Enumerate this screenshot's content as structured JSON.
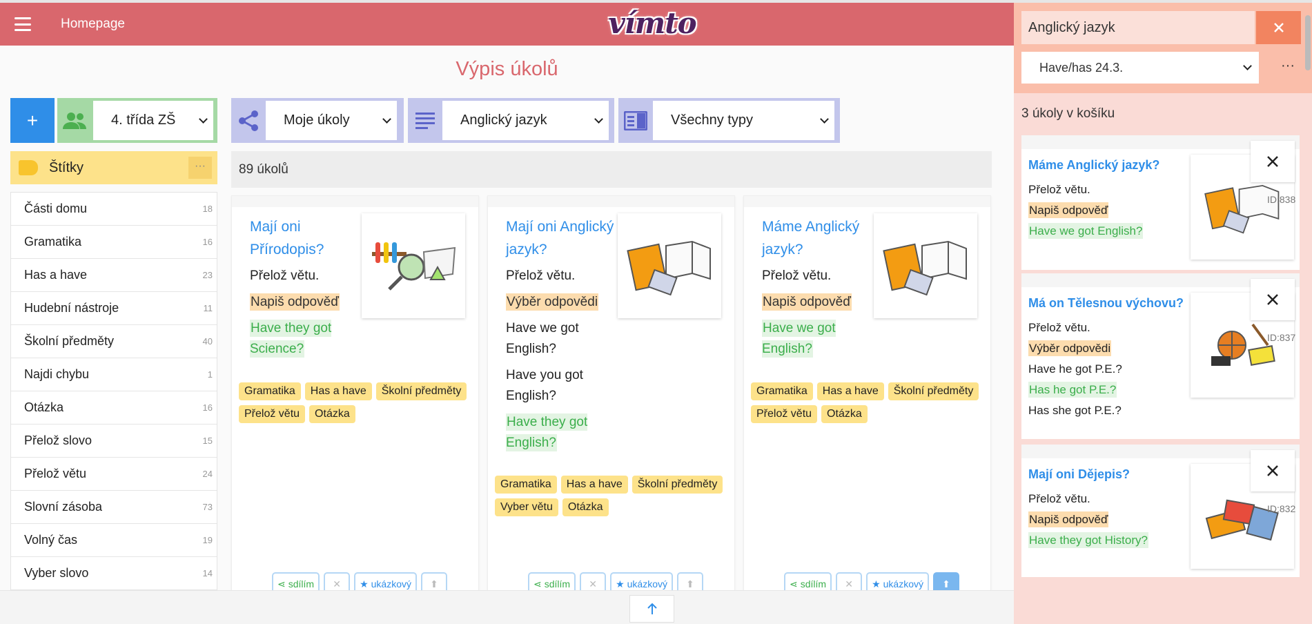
{
  "header": {
    "home_label": "Homepage",
    "logo_text": "vímto"
  },
  "page_title": "Výpis úkolů",
  "left": {
    "class_select": "4. třída ZŠ",
    "tags_label": "Štítky",
    "tags_more": "···",
    "tags": [
      {
        "label": "Části domu",
        "count": "18"
      },
      {
        "label": "Gramatika",
        "count": "16"
      },
      {
        "label": "Has a have",
        "count": "23"
      },
      {
        "label": "Hudební nástroje",
        "count": "11"
      },
      {
        "label": "Školní předměty",
        "count": "40"
      },
      {
        "label": "Najdi chybu",
        "count": "1"
      },
      {
        "label": "Otázka",
        "count": "16"
      },
      {
        "label": "Přelož slovo",
        "count": "15"
      },
      {
        "label": "Přelož větu",
        "count": "24"
      },
      {
        "label": "Slovní zásoba",
        "count": "73"
      },
      {
        "label": "Volný čas",
        "count": "19"
      },
      {
        "label": "Vyber slovo",
        "count": "14"
      }
    ]
  },
  "filters": {
    "owner": "Moje úkoly",
    "subject": "Anglický jazyk",
    "type": "Všechny typy"
  },
  "task_count": "89 úkolů",
  "cards": [
    {
      "title": "Mají oni Přírodopis?",
      "instruction": "Přelož větu.",
      "answer_type": "Napiš odpověď",
      "answer": "Have they got Science?",
      "chips": [
        "Gramatika",
        "Has a have",
        "Školní předměty",
        "Přelož větu",
        "Otázka"
      ]
    },
    {
      "title": "Mají oni Anglický jazyk?",
      "instruction": "Přelož větu.",
      "answer_type": "Výběr odpovědi",
      "option1": "Have we got English?",
      "option2": "Have you got English?",
      "answer": "Have they got English?",
      "chips": [
        "Gramatika",
        "Has a have",
        "Školní předměty",
        "Vyber větu",
        "Otázka"
      ]
    },
    {
      "title": "Máme Anglický jazyk?",
      "instruction": "Přelož větu.",
      "answer_type": "Napiš odpověď",
      "answer": "Have we got English?",
      "chips": [
        "Gramatika",
        "Has a have",
        "Školní předměty",
        "Přelož větu",
        "Otázka"
      ]
    }
  ],
  "card_actions": {
    "share": "sdílím",
    "example": "ukázkový"
  },
  "panel": {
    "subject": "Anglický jazyk",
    "set_select": "Have/has 24.3.",
    "more": "···",
    "basket_count": "3 úkoly v košíku",
    "items": [
      {
        "title": "Máme Anglický jazyk?",
        "instruction": "Přelož větu.",
        "answer_type": "Napiš odpověď",
        "answer": "Have we got English?",
        "id": "ID:838"
      },
      {
        "title": "Má on Tělesnou výchovu?",
        "instruction": "Přelož větu.",
        "answer_type": "Výběr odpovědi",
        "option1": "Have he got P.E.?",
        "answer": "Has he got P.E.?",
        "option2": "Has she got P.E.?",
        "id": "ID:837"
      },
      {
        "title": "Mají oni Dějepis?",
        "instruction": "Přelož větu.",
        "answer_type": "Napiš odpověď",
        "answer": "Have they got History?",
        "id": "ID:832"
      }
    ]
  },
  "colors": {
    "header": "#d9676d",
    "accent_blue": "#2f8ee8",
    "tag_yellow": "#fde28a",
    "green": "#3bae4b",
    "panel": "#fadbd6"
  }
}
